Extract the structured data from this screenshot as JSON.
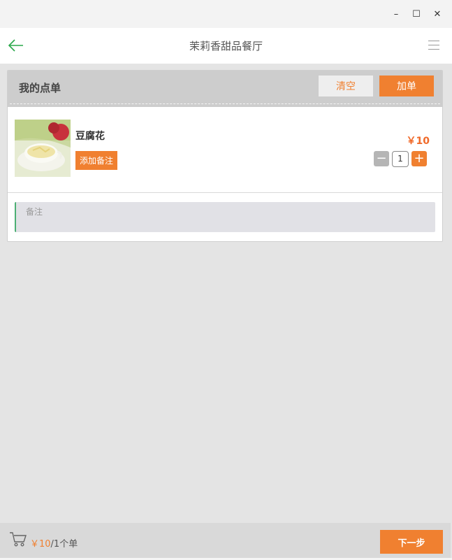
{
  "window": {
    "minimize_label": "–",
    "maximize_label": "☐",
    "close_label": "✕"
  },
  "header": {
    "title": "茉莉香甜品餐厅",
    "back_icon": "back-arrow-icon",
    "menu_icon": "hamburger-menu-icon"
  },
  "order": {
    "title": "我的点单",
    "clear_label": "清空",
    "add_label": "加单",
    "items": [
      {
        "name": "豆腐花",
        "add_note_label": "添加备注",
        "price": "￥10",
        "quantity": "1",
        "minus_label": "−",
        "plus_label": "+"
      }
    ],
    "note_placeholder": "备注"
  },
  "footer": {
    "total_price": "￥10",
    "count_text": "/1个单",
    "next_label": "下一步",
    "cart_icon": "cart-icon"
  },
  "colors": {
    "accent": "#f08030",
    "price": "#f06a2a",
    "back_arrow": "#2aa84a",
    "note_border": "#4caf74"
  }
}
